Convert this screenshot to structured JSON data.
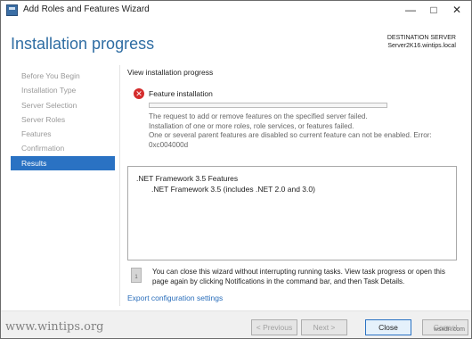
{
  "window": {
    "title": "Add Roles and Features Wizard"
  },
  "header": {
    "page_title": "Installation progress",
    "destination_label": "DESTINATION SERVER",
    "destination_value": "Server2K16.wintips.local"
  },
  "sidebar": {
    "items": [
      {
        "label": "Before You Begin",
        "active": false
      },
      {
        "label": "Installation Type",
        "active": false
      },
      {
        "label": "Server Selection",
        "active": false
      },
      {
        "label": "Server Roles",
        "active": false
      },
      {
        "label": "Features",
        "active": false
      },
      {
        "label": "Confirmation",
        "active": false
      },
      {
        "label": "Results",
        "active": true
      }
    ]
  },
  "main": {
    "view_label": "View installation progress",
    "feature_label": "Feature installation",
    "progress": 0,
    "error_lines": [
      "The request to add or remove features on the specified server failed.",
      "Installation of one or more roles, role services, or features failed.",
      "One or several parent features are disabled so current feature can not be enabled. Error:",
      "0xc004000d"
    ],
    "results": [
      ".NET Framework 3.5 Features",
      ".NET Framework 3.5 (includes .NET 2.0 and 3.0)"
    ],
    "note_lines": [
      "You can close this wizard without interrupting running tasks. View task progress or open this",
      "page again by clicking Notifications in the command bar, and then Task Details."
    ],
    "export_link": "Export configuration settings"
  },
  "footer": {
    "previous": "< Previous",
    "next": "Next >",
    "close": "Close",
    "cancel": "Cancel"
  },
  "watermarks": {
    "left": "www.wintips.org",
    "right": "wsxdn.com"
  },
  "colors": {
    "accent": "#2a72c3",
    "title": "#2f6da3",
    "error": "#d42c2c",
    "link": "#2a6ebb"
  },
  "icons": {
    "app": "server-manager-icon",
    "error": "error-icon",
    "note": "info-note-icon"
  }
}
